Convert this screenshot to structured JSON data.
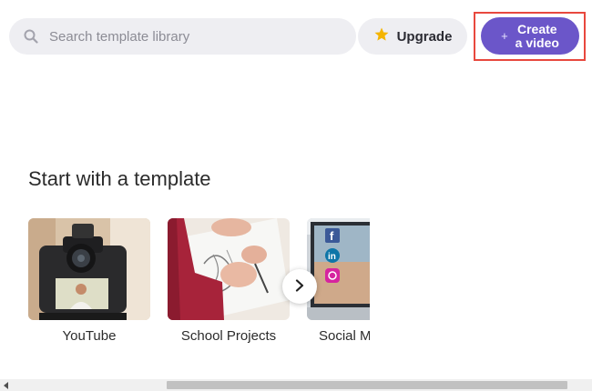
{
  "header": {
    "search_placeholder": "Search template library",
    "upgrade_label": "Upgrade",
    "create_label_line1": "Create",
    "create_label_line2": "a video",
    "create_plus": "+"
  },
  "colors": {
    "accent": "#6b56c9",
    "highlight_border": "#e8483e",
    "star": "#f4b400",
    "pill_background": "#eeeef2"
  },
  "section": {
    "title": "Start with a template"
  },
  "templates": [
    {
      "label": "YouTube",
      "thumbnail": "camera-filming-person"
    },
    {
      "label": "School Projects",
      "thumbnail": "hands-sketching"
    },
    {
      "label": "Social Media",
      "thumbnail": "laptop-social-icons"
    }
  ],
  "carousel": {
    "next_icon": "chevron-right-icon"
  }
}
